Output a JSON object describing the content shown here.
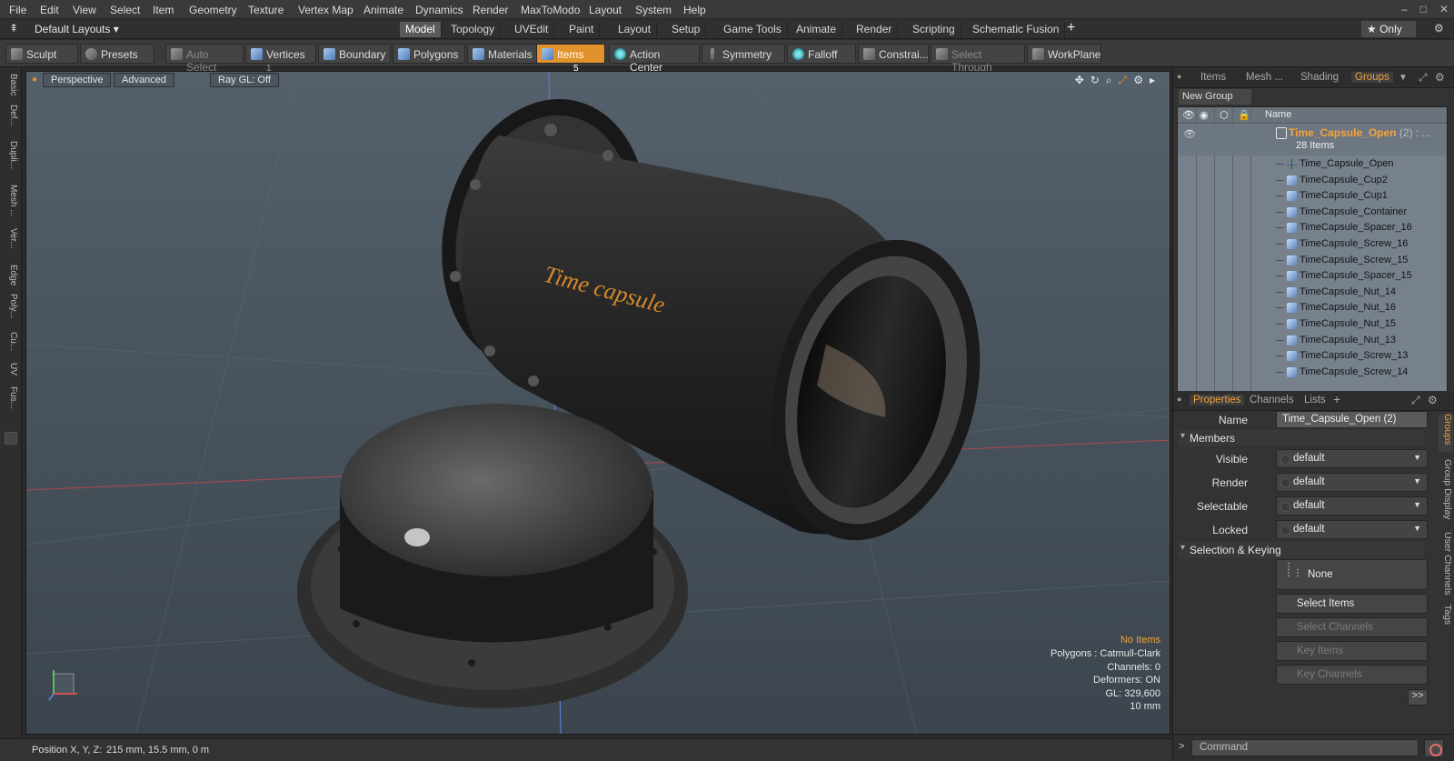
{
  "menubar": {
    "items": [
      "File",
      "Edit",
      "View",
      "Select",
      "Item",
      "Geometry",
      "Texture",
      "Vertex Map",
      "Animate",
      "Dynamics",
      "Render",
      "MaxToModo",
      "Layout",
      "System",
      "Help"
    ]
  },
  "layoutbar": {
    "default_layout": "Default Layouts ▾",
    "tabs": [
      "Model",
      "Topology",
      "UVEdit",
      "Paint",
      "Layout",
      "Setup",
      "Game Tools",
      "Animate",
      "Render",
      "Scripting",
      "Schematic Fusion"
    ],
    "active_tab": "Model",
    "add_label": "+",
    "only_label": "★  Only"
  },
  "toolbar": {
    "sculpt": "Sculpt",
    "presets": "Presets",
    "auto_select": "Auto Select",
    "vertices": "Vertices",
    "vertices_count": "1",
    "boundary": "Boundary",
    "polygons": "Polygons",
    "materials": "Materials",
    "items": "Items",
    "items_count": "5",
    "action_center": "Action Center",
    "symmetry": "Symmetry",
    "falloff": "Falloff",
    "constraints": "Constrai...",
    "select_through": "Select Through",
    "workplane": "WorkPlane"
  },
  "lefttabs": [
    "Basic",
    "Def...",
    "Dupli...",
    "Mesh ...",
    "Ver...",
    "Edge",
    "Poly...",
    "Cu...",
    "UV",
    "Fus..."
  ],
  "viewport": {
    "view_mode": "Perspective",
    "shading": "Advanced",
    "raygl": "Ray GL: Off",
    "object_text": "Time capsule",
    "info": {
      "selection": "No Items",
      "polygons": "Polygons : Catmull-Clark",
      "channels": "Channels: 0",
      "deformers": "Deformers: ON",
      "gl": "GL: 329,600",
      "grid": "10 mm"
    }
  },
  "statusbar": {
    "position_label": "Position X, Y, Z:",
    "position_value": "215 mm, 15.5 mm, 0 m"
  },
  "outliner": {
    "tabs": [
      "Items",
      "Mesh ...",
      "Shading",
      "Groups"
    ],
    "active_tab": "Groups",
    "new_group": "New Group",
    "column_name": "Name",
    "group_name": "Time_Capsule_Open",
    "group_suffix": "(2) : ...",
    "group_count": "28 Items",
    "items": [
      {
        "name": "Time_Capsule_Open",
        "type": "locator"
      },
      {
        "name": "TimeCapsule_Cup2",
        "type": "mesh"
      },
      {
        "name": "TimeCapsule_Cup1",
        "type": "mesh"
      },
      {
        "name": "TimeCapsule_Container",
        "type": "mesh"
      },
      {
        "name": "TimeCapsule_Spacer_16",
        "type": "mesh"
      },
      {
        "name": "TimeCapsule_Screw_16",
        "type": "mesh"
      },
      {
        "name": "TimeCapsule_Screw_15",
        "type": "mesh"
      },
      {
        "name": "TimeCapsule_Spacer_15",
        "type": "mesh"
      },
      {
        "name": "TimeCapsule_Nut_14",
        "type": "mesh"
      },
      {
        "name": "TimeCapsule_Nut_16",
        "type": "mesh"
      },
      {
        "name": "TimeCapsule_Nut_15",
        "type": "mesh"
      },
      {
        "name": "TimeCapsule_Nut_13",
        "type": "mesh"
      },
      {
        "name": "TimeCapsule_Screw_13",
        "type": "mesh"
      },
      {
        "name": "TimeCapsule_Screw_14",
        "type": "mesh"
      }
    ]
  },
  "properties": {
    "tabs": [
      "Properties",
      "Channels",
      "Lists"
    ],
    "active_tab": "Properties",
    "add_label": "+",
    "name_label": "Name",
    "name_value": "Time_Capsule_Open (2)",
    "members_section": "Members",
    "visible_label": "Visible",
    "visible_value": "default",
    "render_label": "Render",
    "render_value": "default",
    "selectable_label": "Selectable",
    "selectable_value": "default",
    "locked_label": "Locked",
    "locked_value": "default",
    "selection_section": "Selection & Keying",
    "none_label": "None",
    "select_items": "Select Items",
    "select_channels": "Select Channels",
    "key_items": "Key Items",
    "key_channels": "Key Channels",
    "more": ">>",
    "side_tabs": [
      "Groups",
      "Group Display",
      "User Channels",
      "Tags"
    ]
  },
  "command": {
    "prompt": ">",
    "placeholder": "Command"
  },
  "colors": {
    "accent": "#e2922c",
    "warning_text": "#f0a23b",
    "viewport_bg": "#4a555f",
    "group_name": "#f5a33c"
  }
}
